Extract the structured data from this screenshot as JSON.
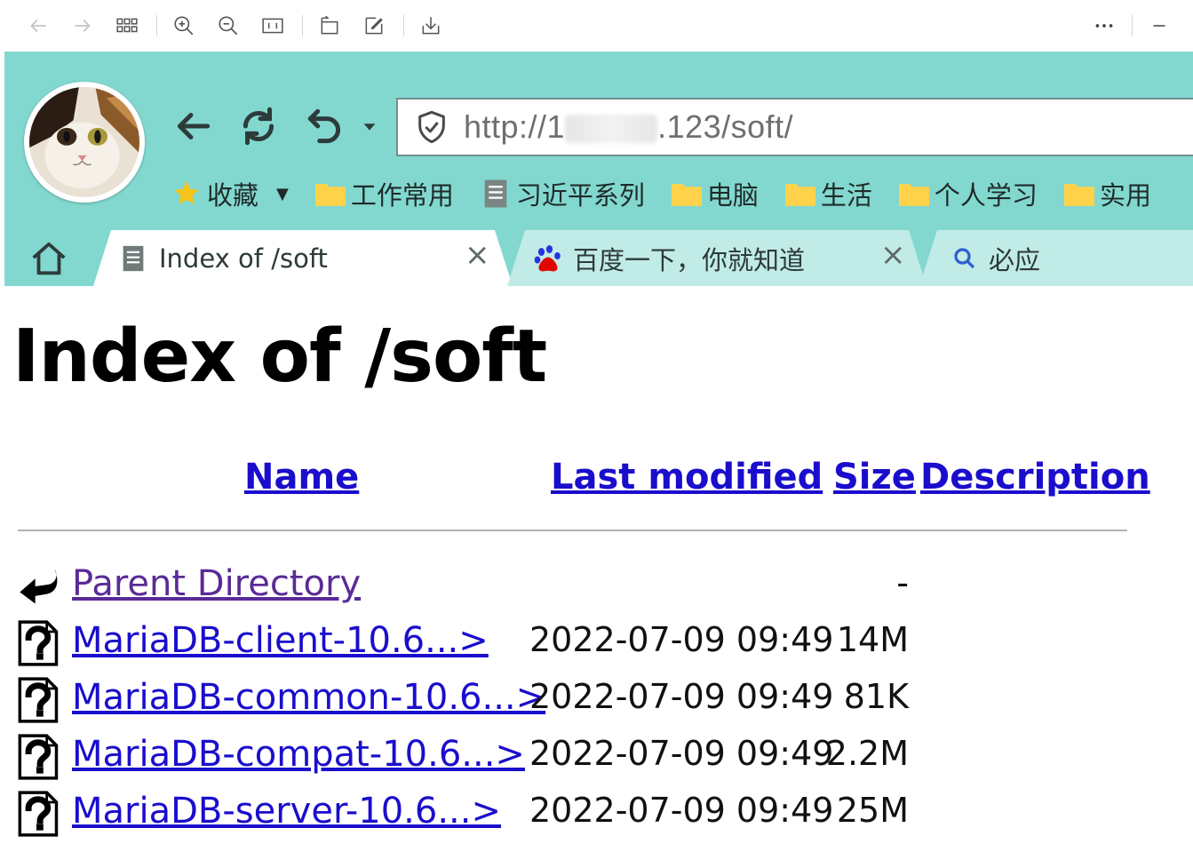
{
  "browser": {
    "address": {
      "scheme_prefix": "http://1",
      "url_suffix": ".123/soft/"
    },
    "bookmarks": [
      "收藏",
      "工作常用",
      "习近平系列",
      "电脑",
      "生活",
      "个人学习",
      "实用"
    ],
    "tabs": [
      {
        "title": "Index of /soft",
        "close": "×"
      },
      {
        "title": "百度一下，你就知道",
        "close": "×"
      },
      {
        "title": "必应"
      }
    ]
  },
  "page": {
    "title": "Index of /soft",
    "columns": {
      "name": "Name",
      "last_modified": "Last modified",
      "size": "Size",
      "description": "Description"
    },
    "rows": [
      {
        "name": "Parent Directory",
        "date": "",
        "size": "-",
        "icon": "back-arrow-icon"
      },
      {
        "name": "MariaDB-client-10.6...>",
        "date": "2022-07-09 09:49",
        "size": "14M",
        "icon": "unknown-file-icon"
      },
      {
        "name": "MariaDB-common-10.6...>",
        "date": "2022-07-09 09:49",
        "size": "81K",
        "icon": "unknown-file-icon"
      },
      {
        "name": "MariaDB-compat-10.6...>",
        "date": "2022-07-09 09:49",
        "size": "2.2M",
        "icon": "unknown-file-icon"
      },
      {
        "name": "MariaDB-server-10.6...>",
        "date": "2022-07-09 09:49",
        "size": "25M",
        "icon": "unknown-file-icon"
      }
    ]
  },
  "colors": {
    "chrome": "#82d8cf",
    "link": "#1a0dcc",
    "visited": "#5a2b96"
  }
}
